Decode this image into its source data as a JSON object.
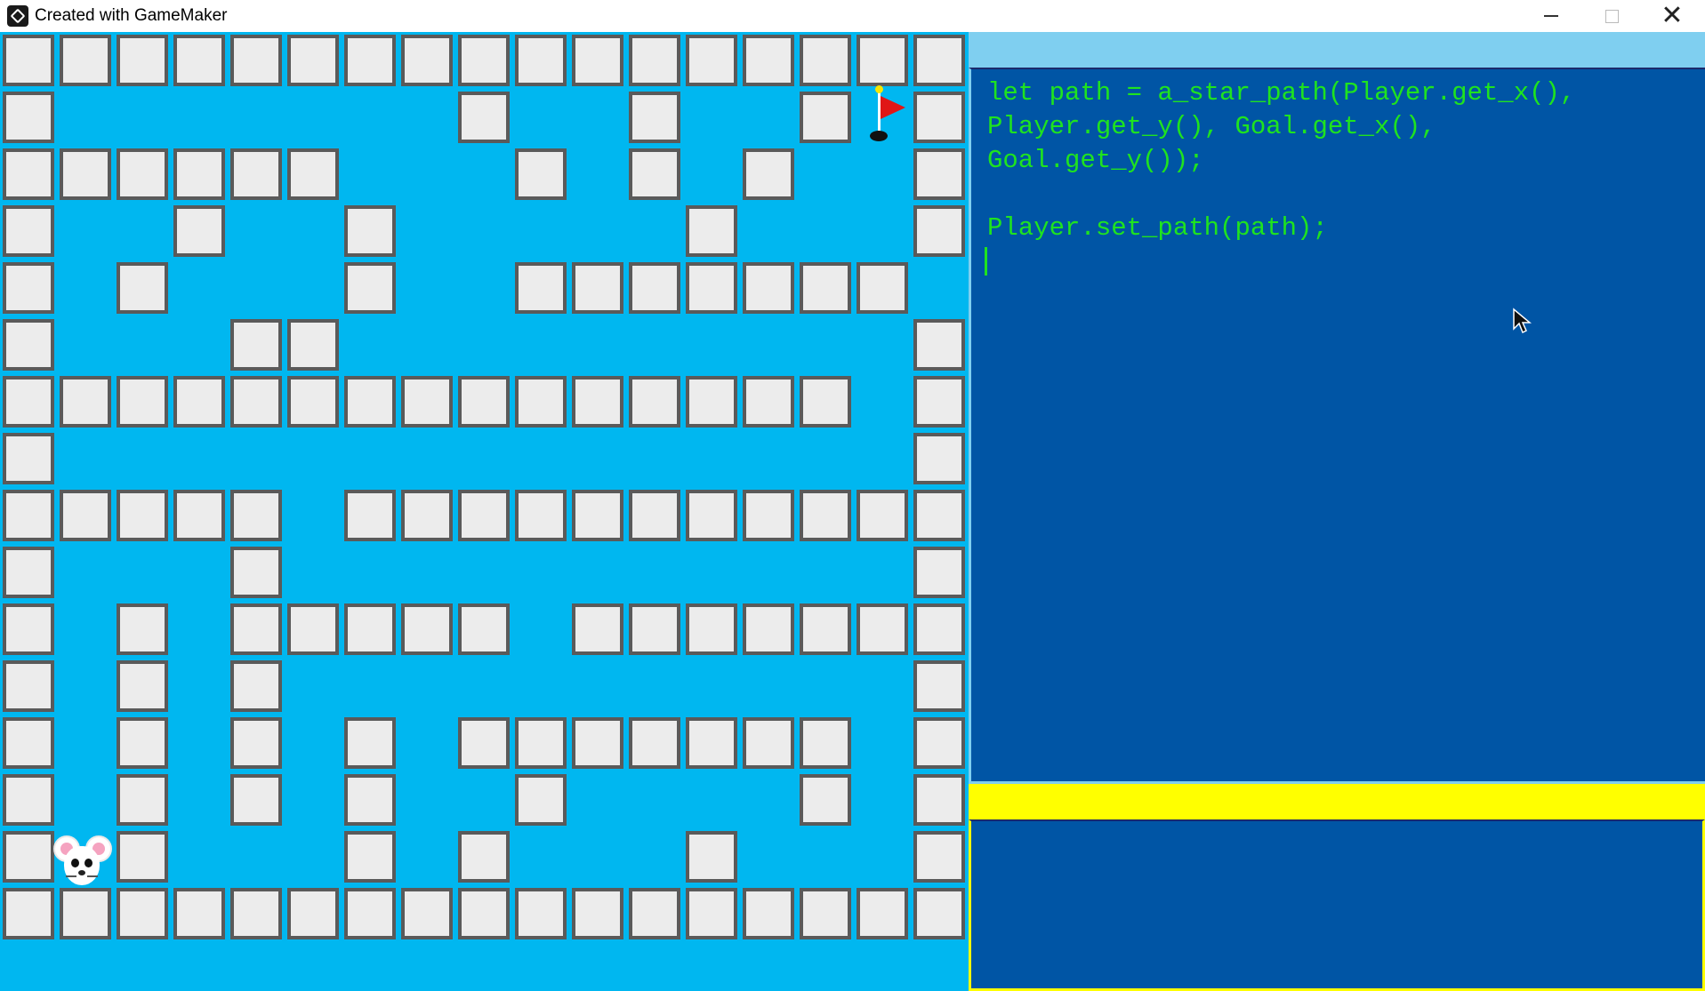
{
  "window": {
    "title": "Created with GameMaker",
    "controls": {
      "minimize": "minimize-icon",
      "maximize": "maximize-icon",
      "close": "close-icon"
    }
  },
  "colors": {
    "water": "#00b7f0",
    "wall_fill": "#ececec",
    "wall_border": "#5a5a5a",
    "editor_bg": "#0055a5",
    "code_text": "#1fe31f",
    "accent_bar": "#ffff00",
    "panel_strip": "#7fcff0"
  },
  "maze": {
    "grid": [
      "#################",
      "#.......#..#..#G#",
      "######...#.#.#..#",
      "#..#..#.....#...#",
      "#.#...#..#######",
      "#...##..........#",
      "###############.#",
      "#...............#",
      "#####.###########",
      "#...#...........#",
      "#.#.#####.#######",
      "#.#.#...........#",
      "#.#.#.#.#######.#",
      "#.#.#.#..#....#.#",
      "#P#...#.#...#...#",
      "#################"
    ],
    "player_icon": "mouse-icon",
    "goal_icon": "flag-icon"
  },
  "editor": {
    "code_lines": [
      "let path = a_star_path(Player.get_x(),",
      "Player.get_y(), Goal.get_x(),",
      "Goal.get_y());",
      "",
      "Player.set_path(path);"
    ],
    "output_text": ""
  }
}
